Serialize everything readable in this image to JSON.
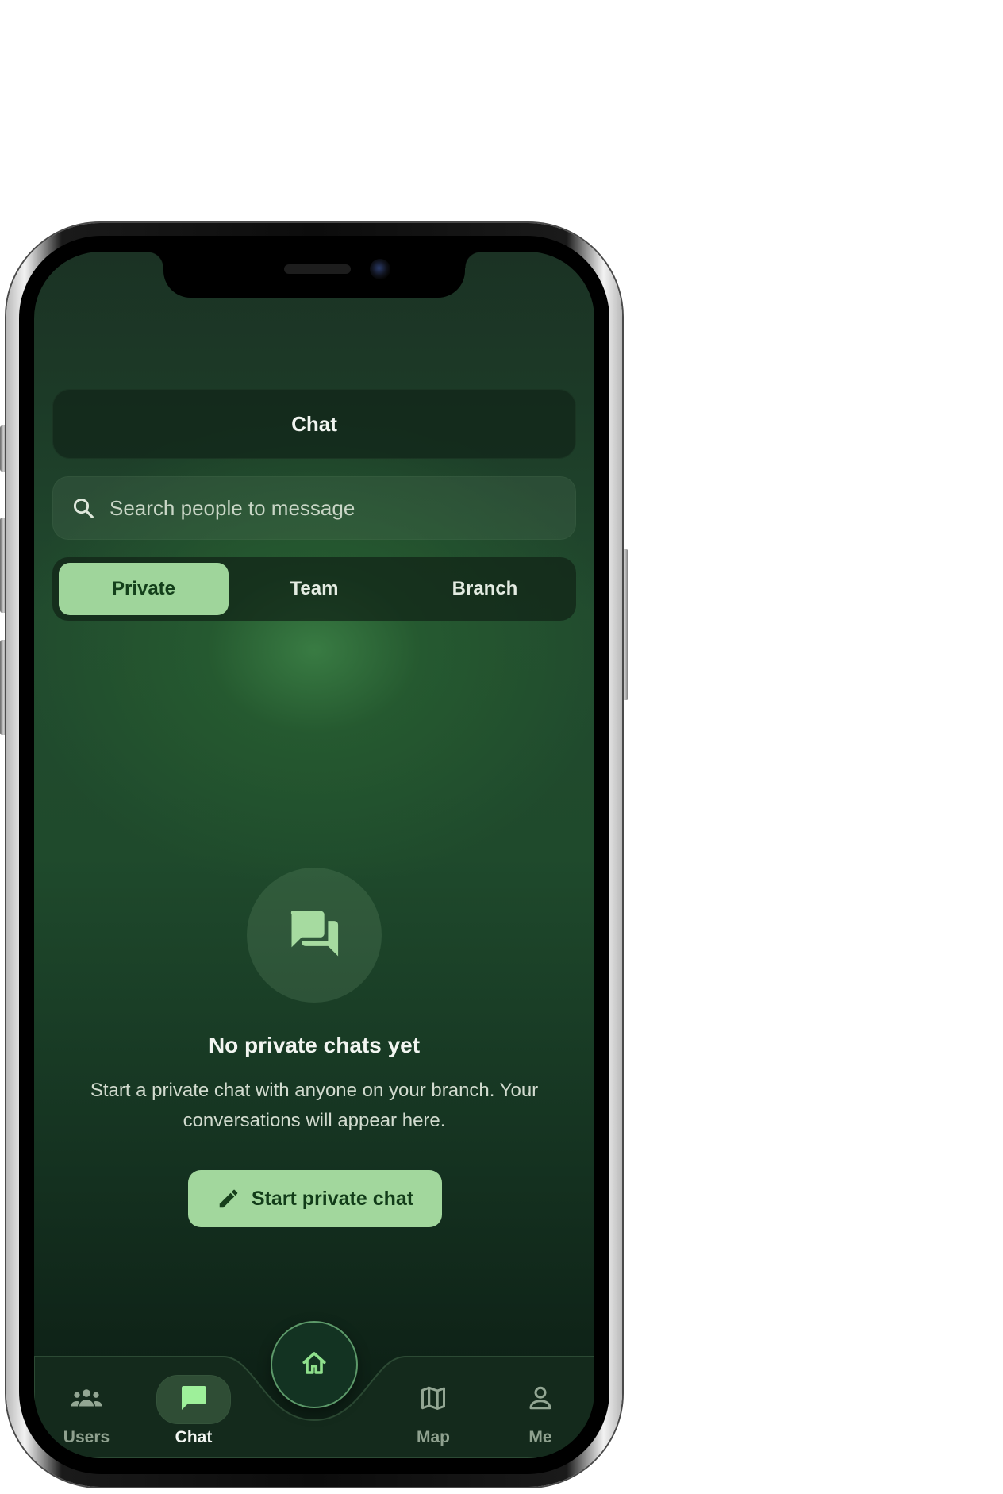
{
  "header": {
    "title": "Chat"
  },
  "search": {
    "placeholder": "Search people to message",
    "value": ""
  },
  "tabs": [
    {
      "label": "Private",
      "active": true
    },
    {
      "label": "Team",
      "active": false
    },
    {
      "label": "Branch",
      "active": false
    }
  ],
  "empty_state": {
    "icon": "forum-icon",
    "title": "No private chats yet",
    "description": "Start a private chat with anyone on your branch. Your conversations will appear here.",
    "cta_label": "Start private chat",
    "cta_icon": "pencil-icon"
  },
  "bottom_nav": {
    "items": [
      {
        "label": "Users",
        "icon": "users-icon",
        "active": false
      },
      {
        "label": "Chat",
        "icon": "chat-icon",
        "active": true
      },
      {
        "label": "Map",
        "icon": "map-icon",
        "active": false
      },
      {
        "label": "Me",
        "icon": "person-icon",
        "active": false
      }
    ],
    "home_icon": "home-icon"
  },
  "colors": {
    "accent": "#9fd59b",
    "accent_text": "#14401b",
    "background_top": "#1b3224",
    "background_glow": "#3a7e44",
    "background_bottom": "#0c1c13",
    "nav_inactive": "#8fa18f",
    "nav_active": "#f4f7f3"
  }
}
